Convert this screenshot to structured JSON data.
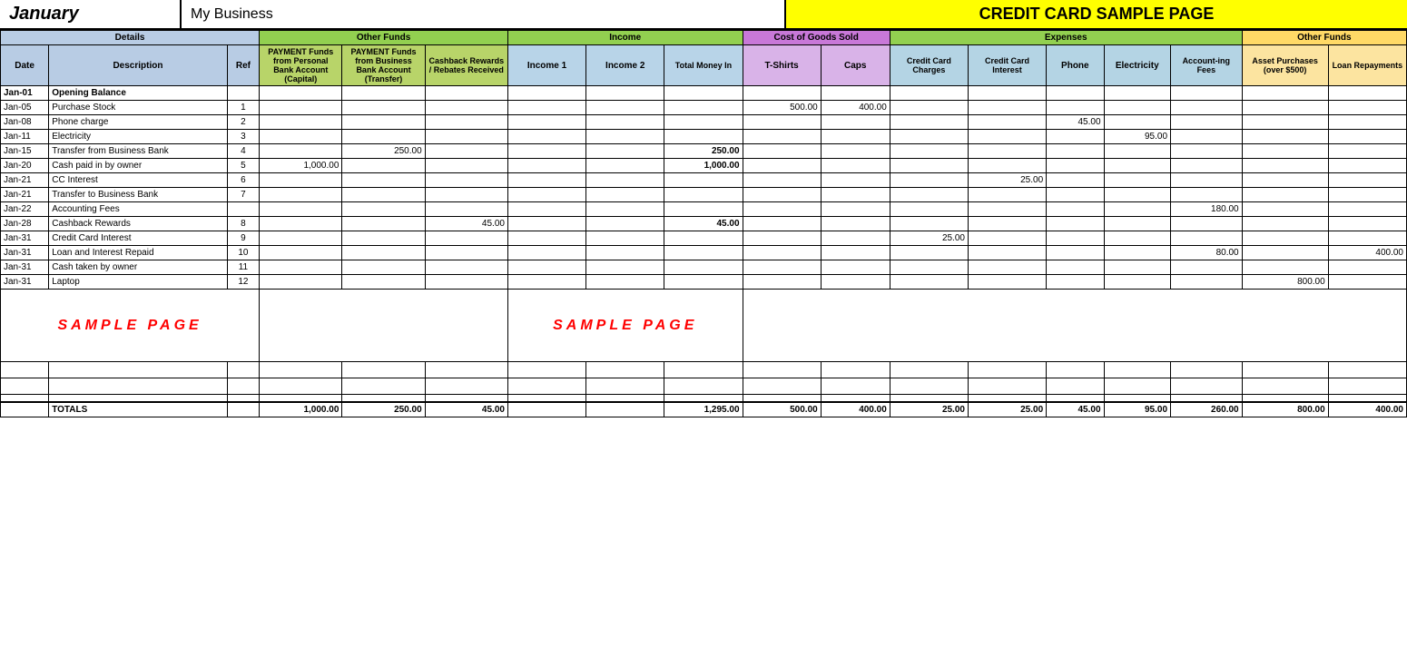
{
  "header": {
    "month": "January",
    "business": "My Business",
    "title": "CREDIT CARD SAMPLE PAGE"
  },
  "columns": {
    "details": "Details",
    "otherFunds": "Other Funds",
    "income": "Income",
    "cogs": "Cost of Goods Sold",
    "expenses": "Expenses",
    "otherFunds2": "Other Funds"
  },
  "subHeaders": {
    "date": "Date",
    "description": "Description",
    "ref": "Ref",
    "personal": "PAYMENT Funds from Personal Bank Account (Capital)",
    "business": "PAYMENT Funds from Business Bank Account (Transfer)",
    "cashback": "Cashback Rewards / Rebates Received",
    "income1": "Income 1",
    "income2": "Income 2",
    "totalMoney": "Total Money In",
    "tshirts": "T-Shirts",
    "caps": "Caps",
    "ccCharges": "Credit Card Charges",
    "ccInterest": "Credit Card Interest",
    "phone": "Phone",
    "electricity": "Electricity",
    "accounting": "Account-ing Fees",
    "assetPurch": "Asset Purchases (over $500)",
    "loanRepay": "Loan Repayments"
  },
  "rows": [
    {
      "date": "Jan-01",
      "desc": "Opening Balance",
      "ref": "",
      "personal": "",
      "business": "",
      "cashback": "",
      "income1": "",
      "income2": "",
      "totalMoney": "",
      "tshirts": "",
      "caps": "",
      "ccCharges": "",
      "ccInterest": "",
      "phone": "",
      "electricity": "",
      "accounting": "",
      "assetPurch": "",
      "loanRepay": "",
      "isOpening": true
    },
    {
      "date": "Jan-05",
      "desc": "Purchase Stock",
      "ref": "1",
      "personal": "",
      "business": "",
      "cashback": "",
      "income1": "",
      "income2": "",
      "totalMoney": "",
      "tshirts": "500.00",
      "caps": "400.00",
      "ccCharges": "",
      "ccInterest": "",
      "phone": "",
      "electricity": "",
      "accounting": "",
      "assetPurch": "",
      "loanRepay": ""
    },
    {
      "date": "Jan-08",
      "desc": "Phone charge",
      "ref": "2",
      "personal": "",
      "business": "",
      "cashback": "",
      "income1": "",
      "income2": "",
      "totalMoney": "",
      "tshirts": "",
      "caps": "",
      "ccCharges": "",
      "ccInterest": "",
      "phone": "45.00",
      "electricity": "",
      "accounting": "",
      "assetPurch": "",
      "loanRepay": ""
    },
    {
      "date": "Jan-11",
      "desc": "Electricity",
      "ref": "3",
      "personal": "",
      "business": "",
      "cashback": "",
      "income1": "",
      "income2": "",
      "totalMoney": "",
      "tshirts": "",
      "caps": "",
      "ccCharges": "",
      "ccInterest": "",
      "phone": "",
      "electricity": "95.00",
      "accounting": "",
      "assetPurch": "",
      "loanRepay": ""
    },
    {
      "date": "Jan-15",
      "desc": "Transfer from Business Bank",
      "ref": "4",
      "personal": "",
      "business": "250.00",
      "cashback": "",
      "income1": "",
      "income2": "",
      "totalMoney": "250.00",
      "tshirts": "",
      "caps": "",
      "ccCharges": "",
      "ccInterest": "",
      "phone": "",
      "electricity": "",
      "accounting": "",
      "assetPurch": "",
      "loanRepay": ""
    },
    {
      "date": "Jan-20",
      "desc": "Cash paid in by owner",
      "ref": "5",
      "personal": "1,000.00",
      "business": "",
      "cashback": "",
      "income1": "",
      "income2": "",
      "totalMoney": "1,000.00",
      "tshirts": "",
      "caps": "",
      "ccCharges": "",
      "ccInterest": "",
      "phone": "",
      "electricity": "",
      "accounting": "",
      "assetPurch": "",
      "loanRepay": ""
    },
    {
      "date": "Jan-21",
      "desc": "CC Interest",
      "ref": "6",
      "personal": "",
      "business": "",
      "cashback": "",
      "income1": "",
      "income2": "",
      "totalMoney": "",
      "tshirts": "",
      "caps": "",
      "ccCharges": "",
      "ccInterest": "25.00",
      "phone": "",
      "electricity": "",
      "accounting": "",
      "assetPurch": "",
      "loanRepay": ""
    },
    {
      "date": "Jan-21",
      "desc": "Transfer to Business Bank",
      "ref": "7",
      "personal": "",
      "business": "",
      "cashback": "",
      "income1": "",
      "income2": "",
      "totalMoney": "",
      "tshirts": "",
      "caps": "",
      "ccCharges": "",
      "ccInterest": "",
      "phone": "",
      "electricity": "",
      "accounting": "",
      "assetPurch": "",
      "loanRepay": ""
    },
    {
      "date": "Jan-22",
      "desc": "Accounting Fees",
      "ref": "",
      "personal": "",
      "business": "",
      "cashback": "",
      "income1": "",
      "income2": "",
      "totalMoney": "",
      "tshirts": "",
      "caps": "",
      "ccCharges": "",
      "ccInterest": "",
      "phone": "",
      "electricity": "",
      "accounting": "180.00",
      "assetPurch": "",
      "loanRepay": ""
    },
    {
      "date": "Jan-28",
      "desc": "Cashback Rewards",
      "ref": "8",
      "personal": "",
      "business": "",
      "cashback": "45.00",
      "income1": "",
      "income2": "",
      "totalMoney": "45.00",
      "tshirts": "",
      "caps": "",
      "ccCharges": "",
      "ccInterest": "",
      "phone": "",
      "electricity": "",
      "accounting": "",
      "assetPurch": "",
      "loanRepay": ""
    },
    {
      "date": "Jan-31",
      "desc": "Credit Card Interest",
      "ref": "9",
      "personal": "",
      "business": "",
      "cashback": "",
      "income1": "",
      "income2": "",
      "totalMoney": "",
      "tshirts": "",
      "caps": "",
      "ccCharges": "25.00",
      "ccInterest": "",
      "phone": "",
      "electricity": "",
      "accounting": "",
      "assetPurch": "",
      "loanRepay": ""
    },
    {
      "date": "Jan-31",
      "desc": "Loan and Interest Repaid",
      "ref": "10",
      "personal": "",
      "business": "",
      "cashback": "",
      "income1": "",
      "income2": "",
      "totalMoney": "",
      "tshirts": "",
      "caps": "",
      "ccCharges": "",
      "ccInterest": "",
      "phone": "",
      "electricity": "",
      "accounting": "80.00",
      "assetPurch": "",
      "loanRepay": "400.00"
    },
    {
      "date": "Jan-31",
      "desc": "Cash taken by owner",
      "ref": "11",
      "personal": "",
      "business": "",
      "cashback": "",
      "income1": "",
      "income2": "",
      "totalMoney": "",
      "tshirts": "",
      "caps": "",
      "ccCharges": "",
      "ccInterest": "",
      "phone": "",
      "electricity": "",
      "accounting": "",
      "assetPurch": "",
      "loanRepay": ""
    },
    {
      "date": "Jan-31",
      "desc": "Laptop",
      "ref": "12",
      "personal": "",
      "business": "",
      "cashback": "",
      "income1": "",
      "income2": "",
      "totalMoney": "",
      "tshirts": "",
      "caps": "",
      "ccCharges": "",
      "ccInterest": "",
      "phone": "",
      "electricity": "",
      "accounting": "",
      "assetPurch": "800.00",
      "loanRepay": ""
    }
  ],
  "blankRows": 4,
  "totals": {
    "date": "",
    "desc": "TOTALS",
    "ref": "",
    "personal": "1,000.00",
    "business": "250.00",
    "cashback": "45.00",
    "income1": "",
    "income2": "",
    "totalMoney": "1,295.00",
    "tshirts": "500.00",
    "caps": "400.00",
    "ccCharges": "25.00",
    "ccInterest": "25.00",
    "phone": "45.00",
    "electricity": "95.00",
    "accounting": "260.00",
    "assetPurch": "800.00",
    "loanRepay": "400.00"
  },
  "sampleText1": "SAMPLE PAGE",
  "sampleText2": "SAMPLE PAGE"
}
